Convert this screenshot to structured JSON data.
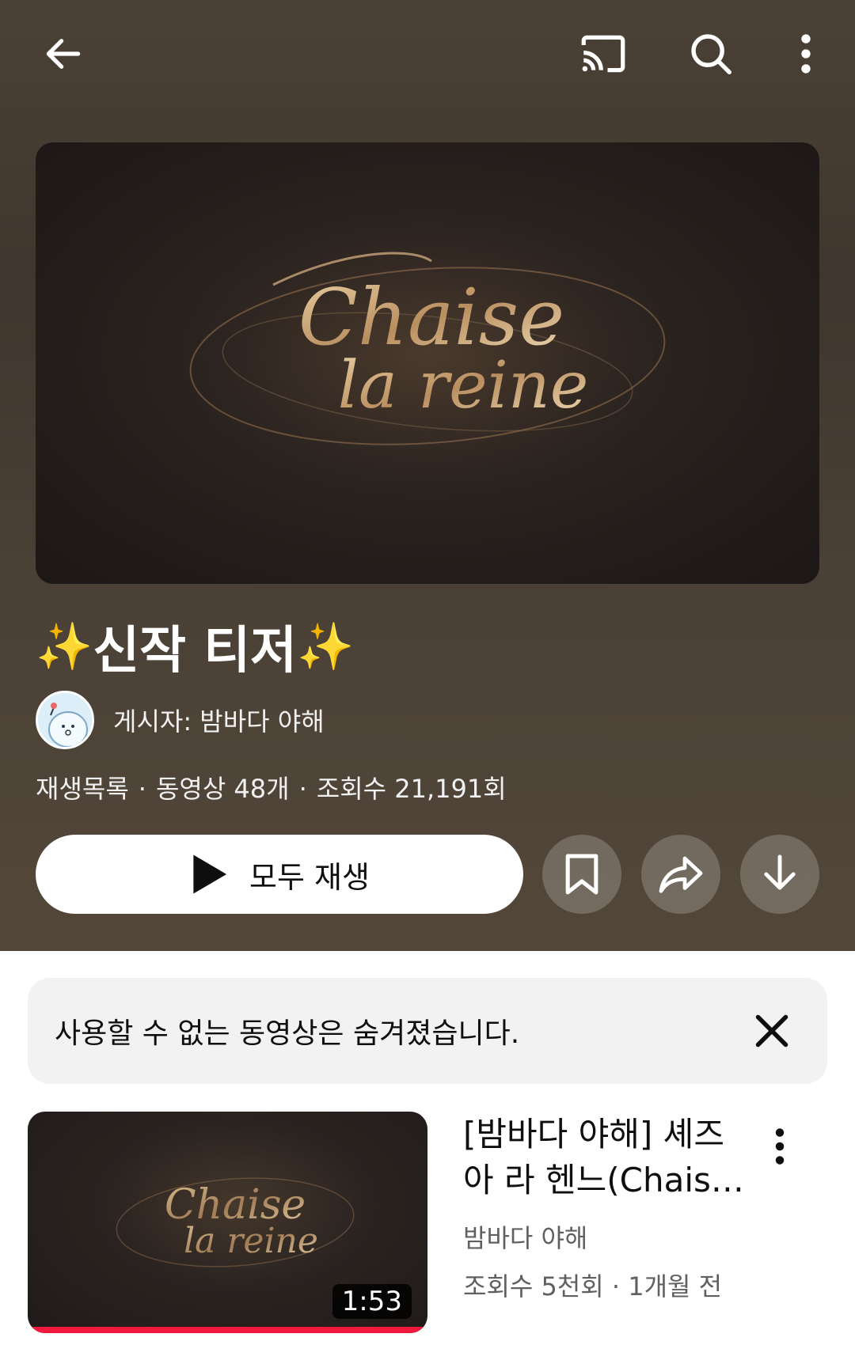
{
  "header": {
    "back_icon": "arrow-left-icon",
    "cast_icon": "cast-icon",
    "search_icon": "search-icon",
    "more_icon": "more-vertical-icon"
  },
  "playlist": {
    "thumbnail_text_1": "Chaise",
    "thumbnail_text_2": "la reine",
    "title_prefix": "✨",
    "title": "신작 티저 ",
    "title_suffix": "✨",
    "author_label": "게시자: 밤바다 야해",
    "meta_type": "재생목록",
    "meta_videos": "동영상 48개",
    "meta_views": "조회수 21,191회",
    "separator": "·",
    "play_all_label": "모두 재생",
    "actions": [
      "bookmark-icon",
      "share-icon",
      "download-icon"
    ]
  },
  "notice": {
    "text": "사용할 수 없는 동영상은 숨겨졌습니다.",
    "close_icon": "close-icon"
  },
  "videos": [
    {
      "thumbnail_text_1": "Chaise",
      "thumbnail_text_2": "la reine",
      "title_line1": "[밤바다 야해] 셰즈",
      "title_line2": "아 라 헨느(Chais…",
      "channel": "밤바다 야해",
      "views": "조회수 5천회",
      "age": "1개월 전",
      "separator": "·",
      "duration": "1:53",
      "watched_fraction": 1.0
    }
  ],
  "colors": {
    "hero_bg": "#4b4136",
    "sparkle": "#f7c22c",
    "progress": "#f0183c",
    "notice_bg": "#f2f2f2"
  }
}
